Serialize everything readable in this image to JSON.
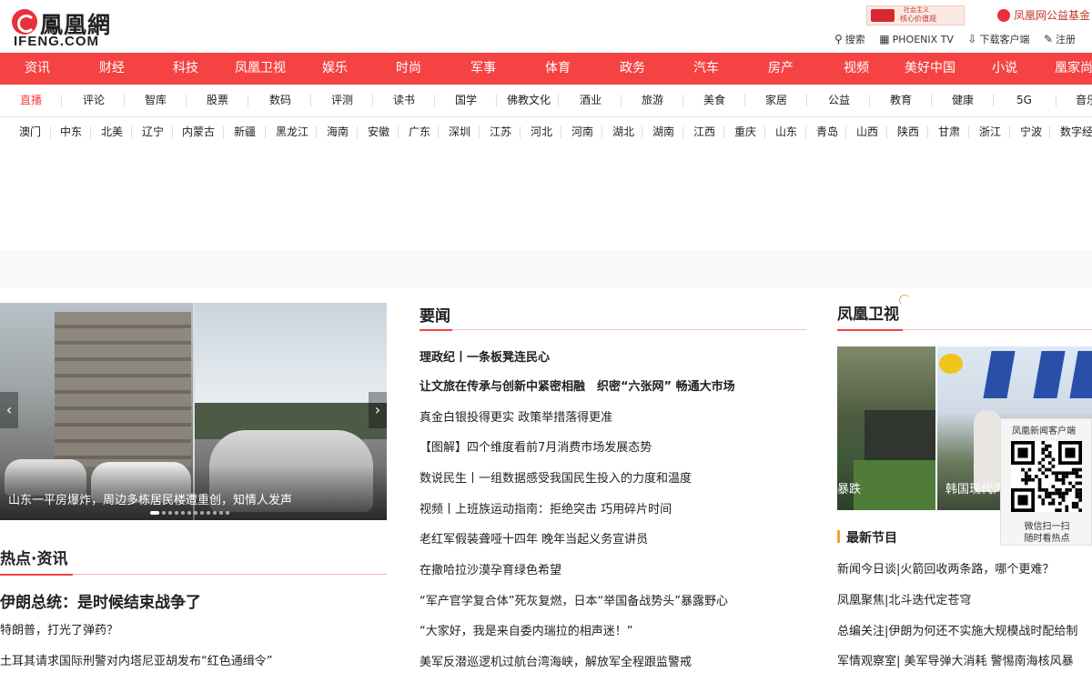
{
  "header": {
    "logo_cn": "鳳凰網",
    "logo_en": "IFENG.COM",
    "promo1_line1": "社会主义",
    "promo1_line2": "核心价值观",
    "promo2": "凤凰网公益基金",
    "links": [
      {
        "icon": "search-icon",
        "label": "搜索"
      },
      {
        "icon": "tv-icon",
        "label": "PHOENIX TV"
      },
      {
        "icon": "download-icon",
        "label": "下载客户端"
      },
      {
        "icon": "edit-icon",
        "label": "注册"
      }
    ]
  },
  "nav_main": [
    "资讯",
    "财经",
    "科技",
    "凤凰卫视",
    "娱乐",
    "时尚",
    "军事",
    "体育",
    "政务",
    "汽车",
    "房产",
    "视频",
    "美好中国",
    "小说",
    "凰家尚品"
  ],
  "nav_sub": [
    "直播",
    "评论",
    "智库",
    "股票",
    "数码",
    "评测",
    "读书",
    "国学",
    "佛教文化",
    "酒业",
    "旅游",
    "美食",
    "家居",
    "公益",
    "教育",
    "健康",
    "5G",
    "音乐"
  ],
  "nav_regions": [
    "澳门",
    "中东",
    "北美",
    "辽宁",
    "内蒙古",
    "新疆",
    "黑龙江",
    "海南",
    "安徽",
    "广东",
    "深圳",
    "江苏",
    "河北",
    "河南",
    "湖北",
    "湖南",
    "江西",
    "重庆",
    "山东",
    "青岛",
    "山西",
    "陕西",
    "甘肃",
    "浙江",
    "宁波",
    "数字经济"
  ],
  "slider": {
    "caption": "山东一平房爆炸，周边多栋居民楼遭重创，知情人发声",
    "prev": "‹",
    "next": "›"
  },
  "hot": {
    "title": "热点·资讯",
    "lead": "伊朗总统：是时候结束战争了",
    "items": [
      "特朗普，打光了弹药？",
      "土耳其请求国际刑警对内塔尼亚胡发布“红色通缉令”"
    ]
  },
  "news": {
    "title": "要闻",
    "items": [
      {
        "text": "理政纪丨一条板凳连民心",
        "bold": true
      },
      {
        "text": "让文旅在传承与创新中紧密相融　织密“六张网” 畅通大市场",
        "bold": true
      },
      {
        "text": "真金白银投得更实 政策举措落得更准",
        "bold": false
      },
      {
        "text": "【图解】四个维度看前7月消费市场发展态势",
        "bold": false
      },
      {
        "text": "数说民生丨一组数据感受我国民生投入的力度和温度",
        "bold": false
      },
      {
        "text": "视频丨上班族运动指南：拒绝突击 巧用碎片时间",
        "bold": false
      },
      {
        "text": "老红军假装聋哑十四年 晚年当起义务宣讲员",
        "bold": false
      },
      {
        "text": "在撒哈拉沙漠孕育绿色希望",
        "bold": false
      },
      {
        "text": "“军产官学复合体”死灰复燃，日本“举国备战势头”暴露野心",
        "bold": false
      },
      {
        "text": "“大家好，我是来自委内瑞拉的相声迷！”",
        "bold": false
      },
      {
        "text": "美军反潜巡逻机过航台湾海峡，解放军全程跟监警戒",
        "bold": false
      }
    ]
  },
  "tv": {
    "title": "凤凰卫视",
    "img1_caption": "暴跌",
    "img2_caption": "韩国现代汽",
    "qr_title": "凤凰新闻客户端",
    "qr_line1": "微信扫一扫",
    "qr_line2": "随时看热点",
    "latest_title": "最新节目",
    "items": [
      "新闻今日谈|火箭回收两条路，哪个更难？",
      "凤凰聚焦|北斗迭代定苍穹",
      "总编关注|伊朗为何还不实施大规模战时配给制",
      "军情观察室| 美军导弹大消耗 警惕南海核风暴"
    ]
  },
  "colors": {
    "brand_red": "#f54343",
    "accent_gold": "#f5a623"
  }
}
